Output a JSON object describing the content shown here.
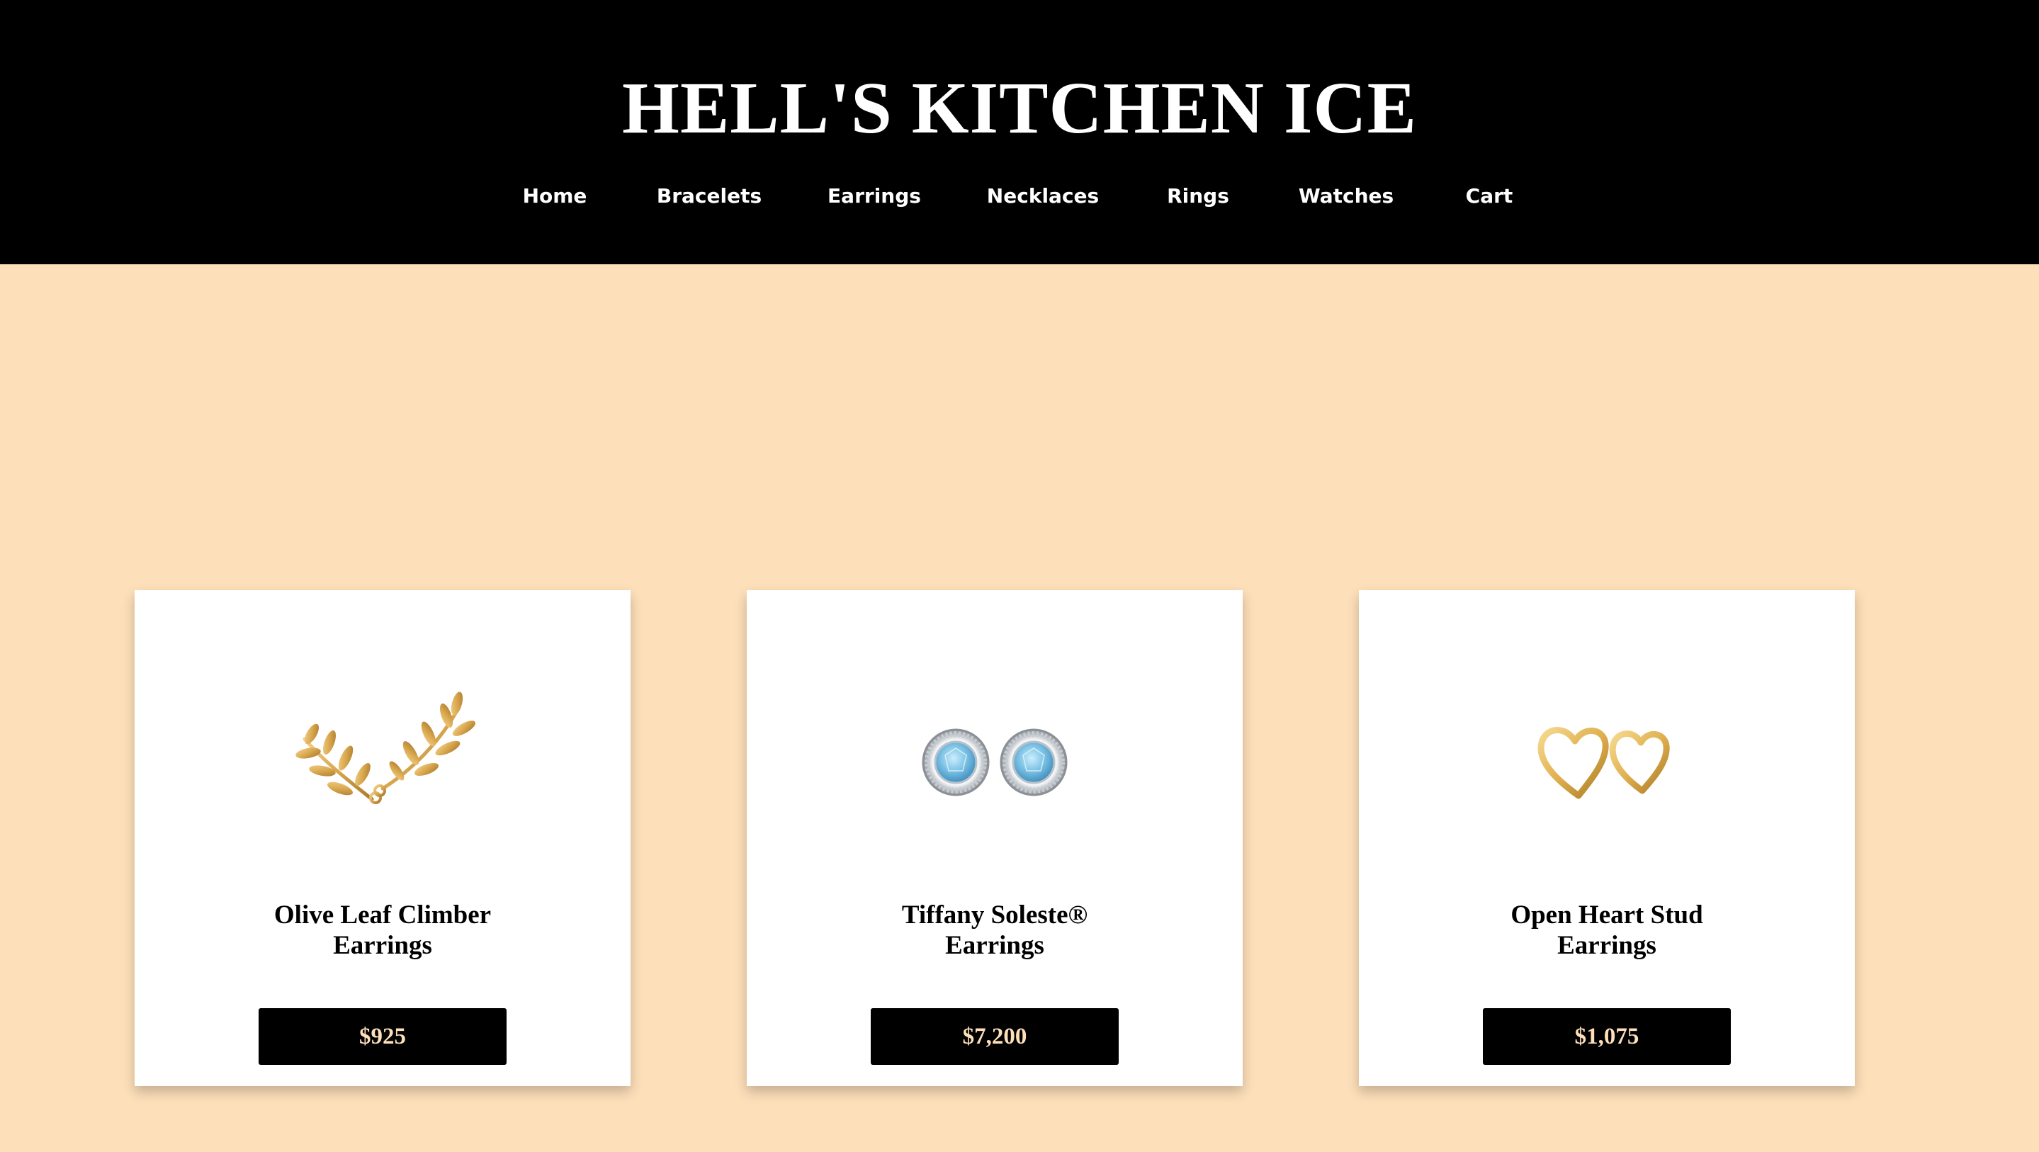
{
  "site": {
    "title": "HELL'S KITCHEN ICE"
  },
  "nav": {
    "items": [
      {
        "label": "Home"
      },
      {
        "label": "Bracelets"
      },
      {
        "label": "Earrings"
      },
      {
        "label": "Necklaces"
      },
      {
        "label": "Rings"
      },
      {
        "label": "Watches"
      },
      {
        "label": "Cart"
      }
    ]
  },
  "products": [
    {
      "name_line1": "Olive Leaf Climber",
      "name_line2": "Earrings",
      "price": "$925",
      "image": "gold-olive-leaf-earrings"
    },
    {
      "name_line1": "Tiffany Soleste®",
      "name_line2": "Earrings",
      "price": "$7,200",
      "image": "aquamarine-halo-earrings"
    },
    {
      "name_line1": "Open Heart Stud",
      "name_line2": "Earrings",
      "price": "$1,075",
      "image": "gold-open-heart-earrings"
    }
  ],
  "colors": {
    "header_bg": "#000000",
    "page_bg": "#fddfb9",
    "button_bg": "#000000",
    "button_text": "#fddfb9",
    "gold": "#d9a84e",
    "aquamarine": "#7fc4e6"
  }
}
